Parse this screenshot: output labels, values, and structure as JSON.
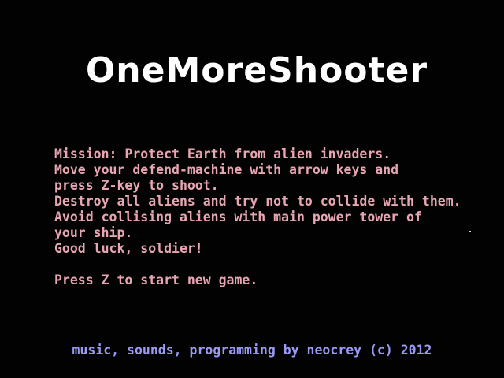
{
  "game": {
    "title": "OneMoreShooter",
    "briefing": [
      "Mission: Protect Earth from alien invaders.",
      "Move your defend-machine with arrow keys and",
      "press Z-key to shoot.",
      "Destroy all aliens and try not to collide with them.",
      "Avoid collising aliens with main power tower of",
      "your ship.",
      "Good luck, soldier!"
    ],
    "start_prompt": "Press Z to start new game.",
    "credits": "music, sounds, programming by neocrey (c) 2012"
  },
  "colors": {
    "background": "#020202",
    "title": "#ffffff",
    "briefing_text": "#e8a5b2",
    "credits_text": "#9a9af2"
  }
}
